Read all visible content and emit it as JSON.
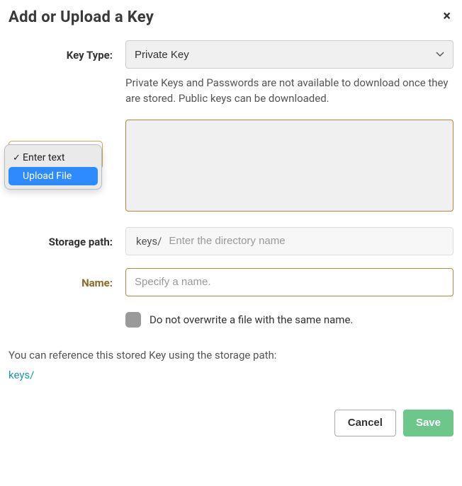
{
  "dialog": {
    "title": "Add or Upload a Key"
  },
  "key_type": {
    "label": "Key Type:",
    "selected": "Private Key",
    "help_text": "Private Keys and Passwords are not available to download once they are stored. Public keys can be downloaded."
  },
  "input_mode": {
    "options": {
      "enter_text": "Enter text",
      "upload_file": "Upload File"
    },
    "selected": "enter_text"
  },
  "key_value": {
    "value": ""
  },
  "storage": {
    "label": "Storage path:",
    "prefix": "keys/",
    "placeholder": "Enter the directory name",
    "value": ""
  },
  "name": {
    "label": "Name:",
    "placeholder": "Specify a name.",
    "value": ""
  },
  "overwrite": {
    "label": "Do not overwrite a file with the same name.",
    "checked": false
  },
  "reference": {
    "text": "You can reference this stored Key using the storage path:",
    "path": "keys/"
  },
  "buttons": {
    "cancel": "Cancel",
    "save": "Save"
  }
}
